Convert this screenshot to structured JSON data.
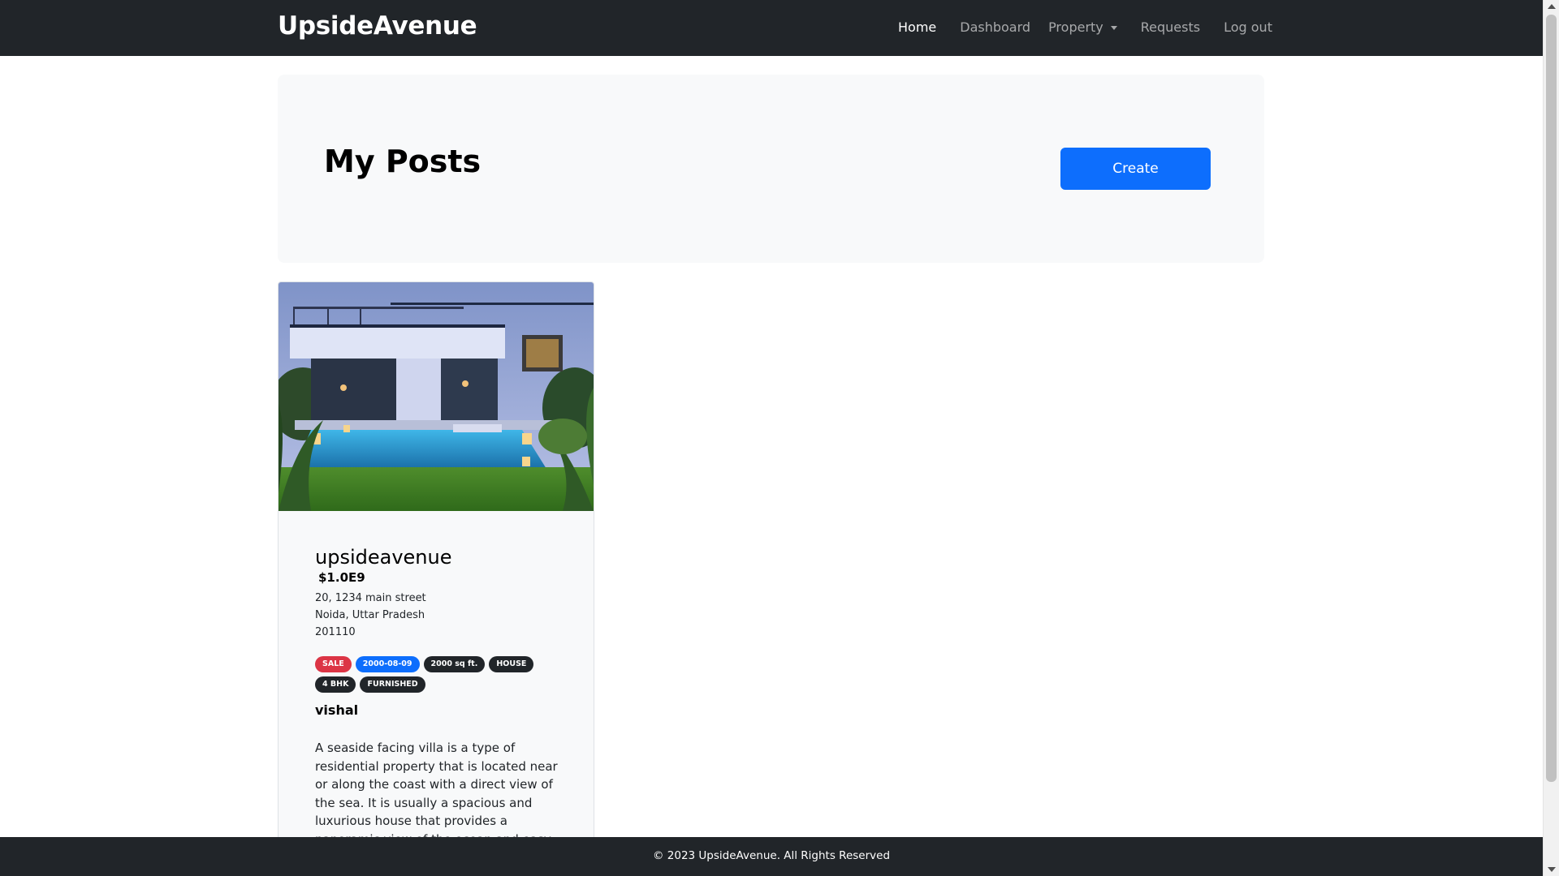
{
  "navbar": {
    "brand": "UpsideAvenue",
    "links": {
      "home": "Home",
      "dashboard": "Dashboard",
      "property": "Property",
      "requests": "Requests",
      "logout": "Log out"
    }
  },
  "hero": {
    "title": "My Posts",
    "create_label": "Create"
  },
  "post": {
    "title": "upsideavenue",
    "price": "$1.0E9",
    "address_line1": "20, 1234 main street",
    "address_line2": "Noida, Uttar Pradesh",
    "postal_code": "201110",
    "badges": {
      "type": "SALE",
      "date": "2000-08-09",
      "area": "2000 sq ft.",
      "category": "HOUSE",
      "bhk": "4 BHK",
      "furnishing": "FURNISHED"
    },
    "owner": "vishal",
    "description": "A seaside facing villa is a type of residential property that is located near or along the coast with a direct view of the sea. It is usually a spacious and luxurious house that provides a panoramic view of the ocean and easy"
  },
  "footer": {
    "text": "© 2023 UpsideAvenue. All Rights Reserved"
  },
  "colors": {
    "navbar_bg": "#212529",
    "primary": "#0d6efd",
    "danger": "#dc3545",
    "panel_bg": "#f8f9fa"
  }
}
